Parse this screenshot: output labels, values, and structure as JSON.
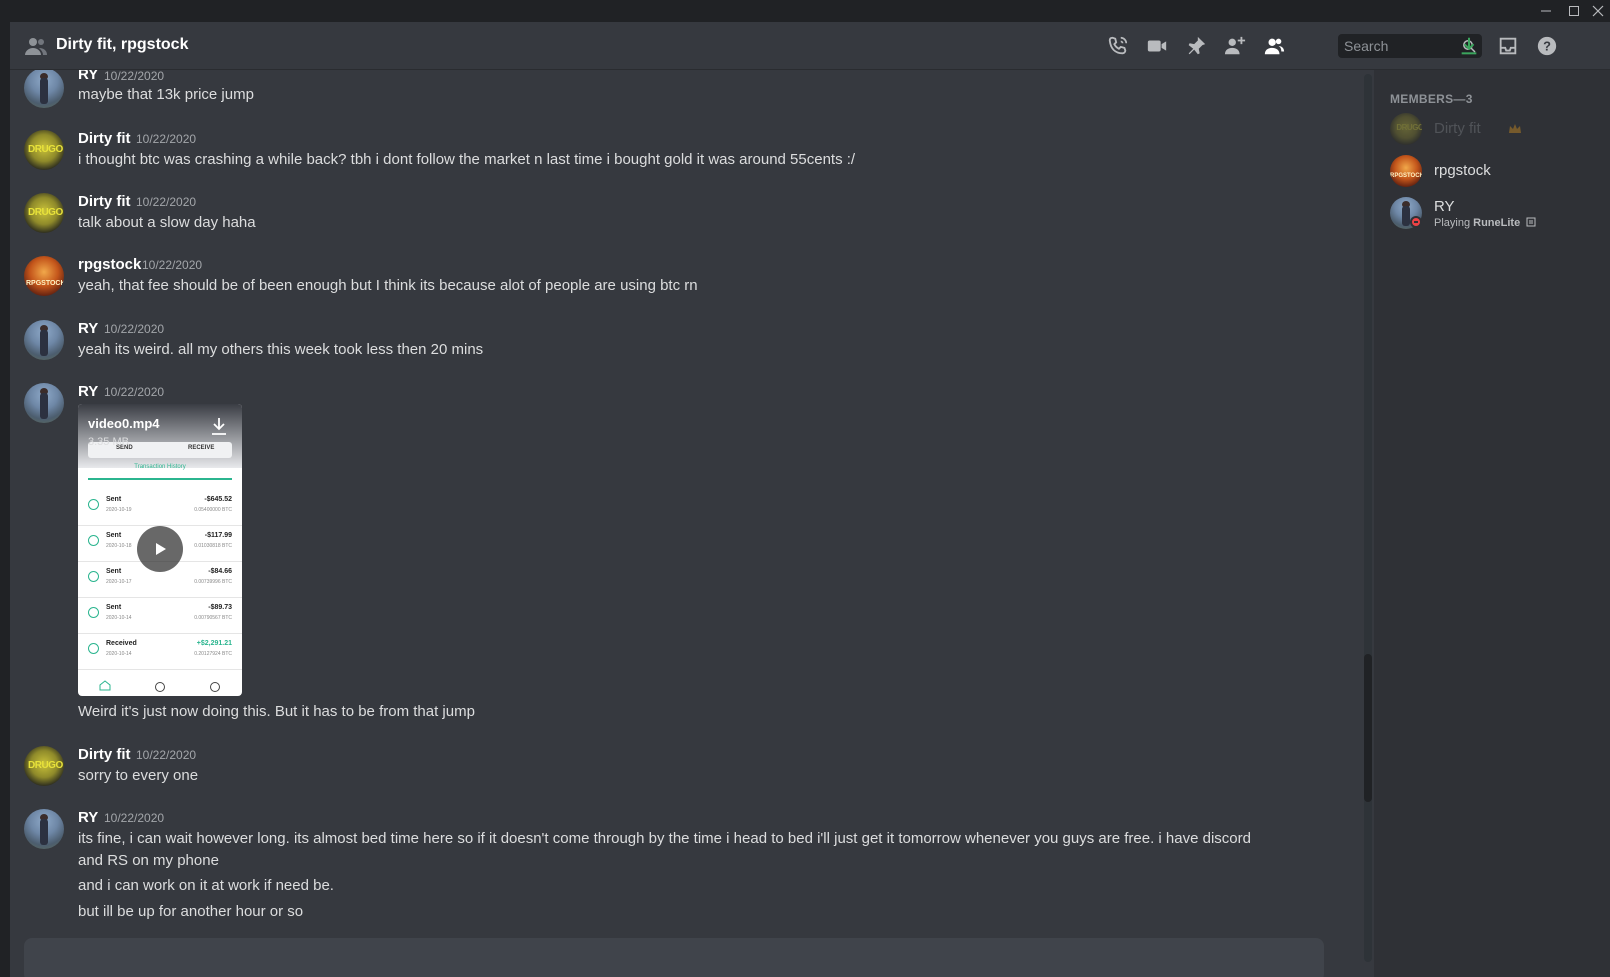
{
  "window": {
    "minimize_glyph": "—",
    "maximize_glyph": "☐",
    "close_glyph": "✕"
  },
  "header": {
    "title": "Dirty fit, rpgstock",
    "search_placeholder": "Search",
    "icons": [
      "dm-people-icon",
      "call-icon",
      "video-call-icon",
      "pin-icon",
      "add-friend-icon",
      "member-list-icon",
      "search-icon",
      "download-icon",
      "inbox-icon",
      "help-icon"
    ],
    "accent_color": "#3ba55d"
  },
  "messages": [
    {
      "author": "RY",
      "timestamp": "10/22/2020",
      "lines": [
        "maybe that 13k price jump"
      ]
    },
    {
      "author": "Dirty fit",
      "timestamp": "10/22/2020",
      "lines": [
        "i thought btc was crashing a while back? tbh i dont follow the market n last time i bought gold it was around 55cents :/"
      ]
    },
    {
      "author": "Dirty fit",
      "timestamp": "10/22/2020",
      "lines": [
        "talk about a slow day haha"
      ]
    },
    {
      "author": "rpgstock",
      "timestamp": "10/22/2020",
      "lines": [
        "yeah, that fee should be of been enough but I think its because alot of people are using btc rn"
      ]
    },
    {
      "author": "RY",
      "timestamp": "10/22/2020",
      "lines": [
        "yeah its weird. all my others this week took less then 20 mins"
      ]
    },
    {
      "author": "RY",
      "timestamp": "10/22/2020",
      "lines": [
        "Weird it's just now doing this. But it has to be from that jump"
      ],
      "attachment": {
        "file_name": "video0.mp4",
        "file_size": "3.35 MB",
        "tabs": [
          "SEND",
          "RECEIVE"
        ],
        "section": "Transaction History",
        "transactions": [
          {
            "type": "Sent",
            "date": "2020-10-19",
            "amount": "-$645.52",
            "btc": "0.05400000 BTC"
          },
          {
            "type": "Sent",
            "date": "2020-10-18",
            "amount": "-$117.99",
            "btc": "0.01030818 BTC"
          },
          {
            "type": "Sent",
            "date": "2020-10-17",
            "amount": "-$84.66",
            "btc": "0.00739996 BTC"
          },
          {
            "type": "Sent",
            "date": "2020-10-14",
            "amount": "-$89.73",
            "btc": "0.00790567 BTC"
          },
          {
            "type": "Received",
            "date": "2020-10-14",
            "amount": "+$2,291.21",
            "btc": "0.20127924 BTC"
          }
        ]
      }
    },
    {
      "author": "Dirty fit",
      "timestamp": "10/22/2020",
      "lines": [
        "sorry to every one"
      ]
    },
    {
      "author": "RY",
      "timestamp": "10/22/2020",
      "lines": [
        "its fine, i can wait however long. its almost bed time here so if it doesn't come through by the time i head to bed i'll just get it tomorrow whenever you guys are free. i have discord and RS on my phone",
        "and i can work on it at work if need be.",
        "but ill be up for another hour or so"
      ]
    }
  ],
  "members": {
    "heading": "MEMBERS—3",
    "list": [
      {
        "name": "Dirty fit",
        "owner_icon": "crown-icon",
        "status": "offline"
      },
      {
        "name": "rpgstock",
        "status": "online"
      },
      {
        "name": "RY",
        "activity_prefix": "Playing ",
        "activity_name": "RuneLite",
        "status": "dnd"
      }
    ]
  }
}
